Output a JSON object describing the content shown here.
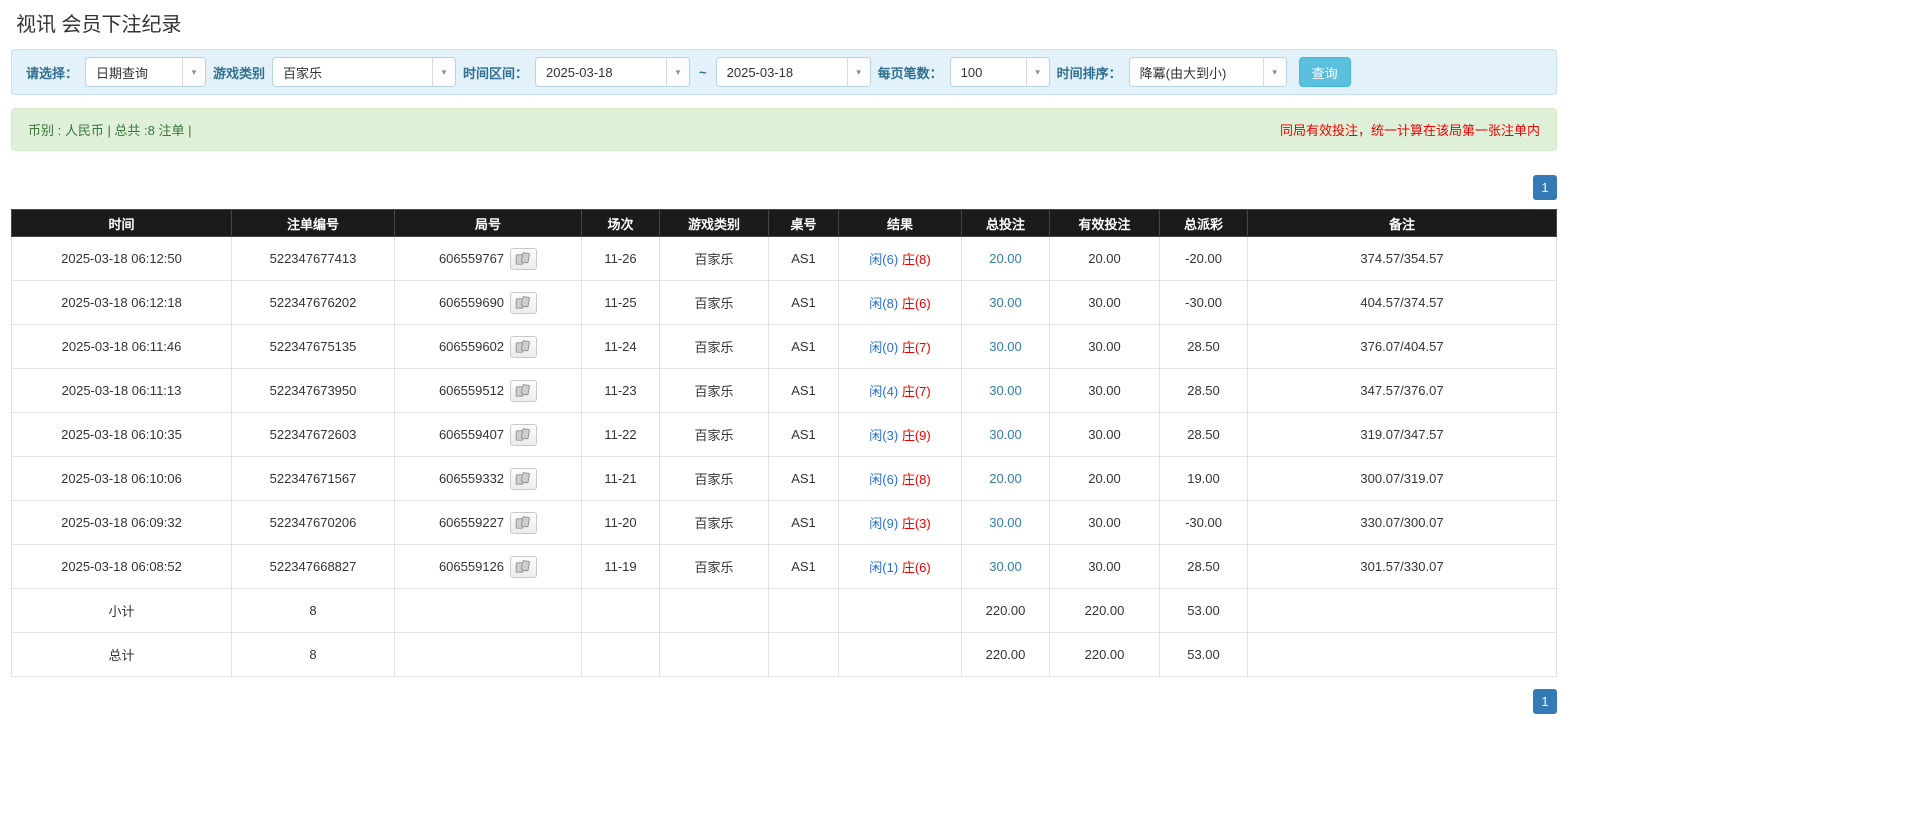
{
  "page": {
    "title": "视讯 会员下注纪录"
  },
  "icons": {
    "caret": "▾"
  },
  "filters": {
    "query_type": {
      "label": "请选择：",
      "value": "日期查询"
    },
    "game_type": {
      "label": "游戏类别",
      "value": "百家乐"
    },
    "time_range": {
      "label": "时间区间：",
      "from": "2025-03-18",
      "separator": "~",
      "to": "2025-03-18"
    },
    "page_size": {
      "label": "每页笔数：",
      "value": "100"
    },
    "sort": {
      "label": "时间排序：",
      "value": "降冪(由大到小)"
    },
    "search_button": "查询"
  },
  "info_bar": {
    "left": "币别 : 人民币 | 总共 :8 注单 |",
    "right": "同局有效投注，统一计算在该局第一张注单内"
  },
  "pagination": {
    "page": "1"
  },
  "table": {
    "headers": [
      "时间",
      "注单编号",
      "局号",
      "场次",
      "游戏类别",
      "桌号",
      "结果",
      "总投注",
      "有效投注",
      "总派彩",
      "备注"
    ],
    "rows": [
      {
        "time": "2025-03-18 06:12:50",
        "bet_id": "522347677413",
        "round_id": "606559767",
        "session": "11-26",
        "game": "百家乐",
        "table_no": "AS1",
        "player": "闲(6)",
        "banker": "庄(8)",
        "total_bet": "20.00",
        "valid_bet": "20.00",
        "payout": "-20.00",
        "remark": "374.57/354.57",
        "highlight": false
      },
      {
        "time": "2025-03-18 06:12:18",
        "bet_id": "522347676202",
        "round_id": "606559690",
        "session": "11-25",
        "game": "百家乐",
        "table_no": "AS1",
        "player": "闲(8)",
        "banker": "庄(6)",
        "total_bet": "30.00",
        "valid_bet": "30.00",
        "payout": "-30.00",
        "remark": "404.57/374.57",
        "highlight": false
      },
      {
        "time": "2025-03-18 06:11:46",
        "bet_id": "522347675135",
        "round_id": "606559602",
        "session": "11-24",
        "game": "百家乐",
        "table_no": "AS1",
        "player": "闲(0)",
        "banker": "庄(7)",
        "total_bet": "30.00",
        "valid_bet": "30.00",
        "payout": "28.50",
        "remark": "376.07/404.57",
        "highlight": false
      },
      {
        "time": "2025-03-18 06:11:13",
        "bet_id": "522347673950",
        "round_id": "606559512",
        "session": "11-23",
        "game": "百家乐",
        "table_no": "AS1",
        "player": "闲(4)",
        "banker": "庄(7)",
        "total_bet": "30.00",
        "valid_bet": "30.00",
        "payout": "28.50",
        "remark": "347.57/376.07",
        "highlight": false
      },
      {
        "time": "2025-03-18 06:10:35",
        "bet_id": "522347672603",
        "round_id": "606559407",
        "session": "11-22",
        "game": "百家乐",
        "table_no": "AS1",
        "player": "闲(3)",
        "banker": "庄(9)",
        "total_bet": "30.00",
        "valid_bet": "30.00",
        "payout": "28.50",
        "remark": "319.07/347.57",
        "highlight": false
      },
      {
        "time": "2025-03-18 06:10:06",
        "bet_id": "522347671567",
        "round_id": "606559332",
        "session": "11-21",
        "game": "百家乐",
        "table_no": "AS1",
        "player": "闲(6)",
        "banker": "庄(8)",
        "total_bet": "20.00",
        "valid_bet": "20.00",
        "payout": "19.00",
        "remark": "300.07/319.07",
        "highlight": true
      },
      {
        "time": "2025-03-18 06:09:32",
        "bet_id": "522347670206",
        "round_id": "606559227",
        "session": "11-20",
        "game": "百家乐",
        "table_no": "AS1",
        "player": "闲(9)",
        "banker": "庄(3)",
        "total_bet": "30.00",
        "valid_bet": "30.00",
        "payout": "-30.00",
        "remark": "330.07/300.07",
        "highlight": false
      },
      {
        "time": "2025-03-18 06:08:52",
        "bet_id": "522347668827",
        "round_id": "606559126",
        "session": "11-19",
        "game": "百家乐",
        "table_no": "AS1",
        "player": "闲(1)",
        "banker": "庄(6)",
        "total_bet": "30.00",
        "valid_bet": "30.00",
        "payout": "28.50",
        "remark": "301.57/330.07",
        "highlight": false
      }
    ],
    "subtotal": {
      "label": "小计",
      "count": "8",
      "total_bet": "220.00",
      "valid_bet": "220.00",
      "payout": "53.00"
    },
    "grand_total": {
      "label": "总计",
      "count": "8",
      "total_bet": "220.00",
      "valid_bet": "220.00",
      "payout": "53.00"
    }
  }
}
